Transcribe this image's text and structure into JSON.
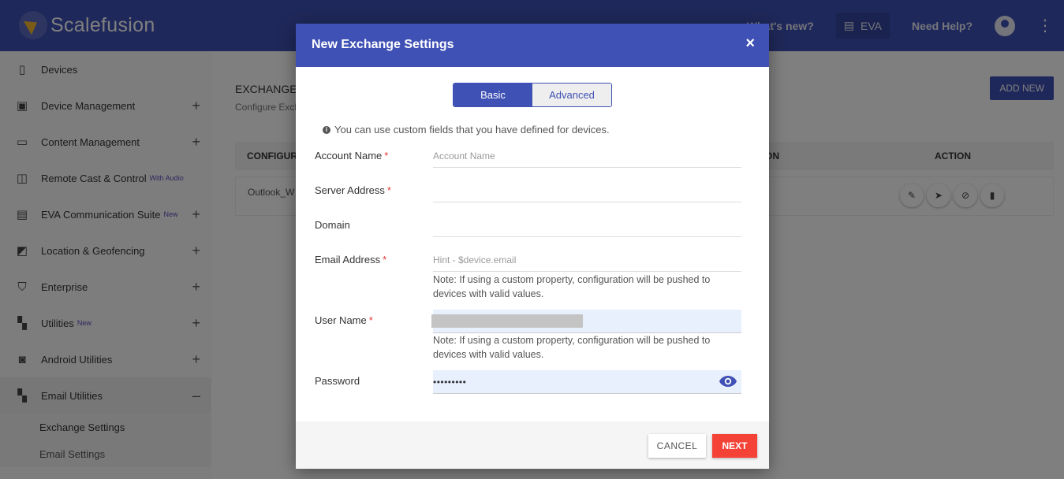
{
  "app": {
    "brand": "Scalefusion"
  },
  "header": {
    "whats_new": "What's new?",
    "eva": "EVA",
    "need_help": "Need Help?"
  },
  "sidebar": {
    "items": [
      {
        "label": "Devices",
        "icon": "phone-icon",
        "expandable": false
      },
      {
        "label": "Device Management",
        "icon": "briefcase-icon",
        "expandable": true
      },
      {
        "label": "Content Management",
        "icon": "folder-icon",
        "expandable": true
      },
      {
        "label": "Remote Cast & Control",
        "badge": "With Audio",
        "icon": "cast-icon",
        "expandable": false
      },
      {
        "label": "EVA Communication Suite",
        "badge": "New",
        "icon": "chat-icon",
        "expandable": true
      },
      {
        "label": "Location & Geofencing",
        "icon": "map-icon",
        "expandable": true
      },
      {
        "label": "Enterprise",
        "icon": "shield-icon",
        "expandable": true
      },
      {
        "label": "Utilities",
        "badge": "New",
        "icon": "widgets-icon",
        "expandable": true
      },
      {
        "label": "Android Utilities",
        "icon": "android-icon",
        "expandable": true
      },
      {
        "label": "Email Utilities",
        "icon": "widgets-icon",
        "expandable": true,
        "expanded": true
      }
    ],
    "subitems": [
      {
        "label": "Exchange Settings",
        "active": true
      },
      {
        "label": "Email Settings",
        "active": false
      }
    ]
  },
  "main": {
    "title": "EXCHANGE",
    "subtitle": "Configure Exch",
    "add_new": "ADD NEW",
    "columns": [
      "CONFIGURA",
      "ON",
      "ACTION"
    ],
    "rows": [
      {
        "name": "Outlook_W"
      }
    ]
  },
  "modal": {
    "title": "New Exchange Settings",
    "close": "×",
    "tabs": {
      "basic": "Basic",
      "advanced": "Advanced"
    },
    "info": "You can use custom fields that you have defined for devices.",
    "fields": {
      "account_name": {
        "label": "Account Name",
        "required": "*",
        "placeholder": "Account Name",
        "value": ""
      },
      "server_address": {
        "label": "Server Address",
        "required": "*",
        "value": ""
      },
      "domain": {
        "label": "Domain",
        "value": ""
      },
      "email_address": {
        "label": "Email Address",
        "required": "*",
        "placeholder": "Hint - $device.email",
        "note": "Note: If using a custom property, configuration will be pushed to devices with valid values."
      },
      "user_name": {
        "label": "User Name",
        "required": "*",
        "note": "Note: If using a custom property, configuration will be pushed to devices with valid values."
      },
      "password": {
        "label": "Password",
        "value": "•••••••••"
      }
    },
    "cancel": "CANCEL",
    "next": "NEXT"
  },
  "colors": {
    "primary": "#3f51b5",
    "danger": "#f44336",
    "required": "#e53935"
  }
}
